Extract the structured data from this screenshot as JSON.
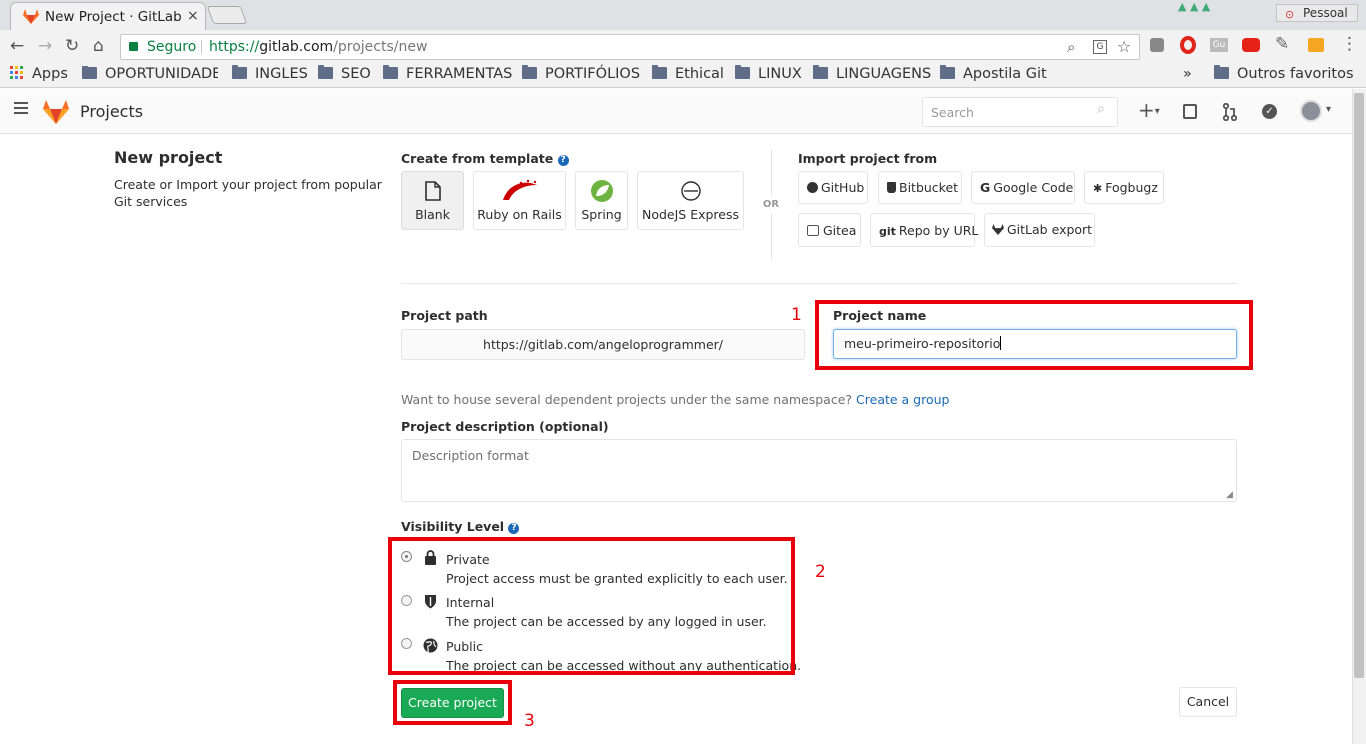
{
  "browser": {
    "tab_title": "New Project · GitLab",
    "tab_close": "×",
    "profile": "Pessoal",
    "secure_label": "Seguro",
    "url_scheme": "https://",
    "url_host": "gitlab.com",
    "url_path": "/projects/new"
  },
  "bookmarks": {
    "apps": "Apps",
    "items": [
      "OPORTUNIDADE",
      "INGLES",
      "SEO",
      "FERRAMENTAS",
      "PORTIFÓLIOS",
      "Ethical",
      "LINUX",
      "LINGUAGENS",
      "Apostila Git"
    ],
    "more": "»",
    "other": "Outros favoritos"
  },
  "header": {
    "title": "Projects",
    "search_placeholder": "Search"
  },
  "sidebar": {
    "title": "New project",
    "description": "Create or Import your project from popular Git services"
  },
  "templates": {
    "label": "Create from template",
    "items": [
      "Blank",
      "Ruby on Rails",
      "Spring",
      "NodeJS Express"
    ],
    "or": "OR"
  },
  "import": {
    "label": "Import project from",
    "items": [
      "GitHub",
      "Bitbucket",
      "Google Code",
      "Fogbugz",
      "Gitea",
      "Repo by URL",
      "GitLab export"
    ]
  },
  "form": {
    "path_label": "Project path",
    "path_value": "https://gitlab.com/angeloprogrammer/",
    "name_label": "Project name",
    "name_value": "meu-primeiro-repositorio",
    "group_hint": "Want to house several dependent projects under the same namespace?",
    "group_link": "Create a group",
    "description_label": "Project description (optional)",
    "description_placeholder": "Description format",
    "visibility_label": "Visibility Level",
    "visibility": [
      {
        "title": "Private",
        "desc": "Project access must be granted explicitly to each user."
      },
      {
        "title": "Internal",
        "desc": "The project can be accessed by any logged in user."
      },
      {
        "title": "Public",
        "desc": "The project can be accessed without any authentication."
      }
    ],
    "create_button": "Create project",
    "cancel_button": "Cancel"
  },
  "annotations": [
    "1",
    "2",
    "3"
  ],
  "colors": {
    "accent": "#1aaa55",
    "link": "#1b69b6",
    "annotation": "#e8000a",
    "gitlab_orange": "#fc6d26"
  }
}
